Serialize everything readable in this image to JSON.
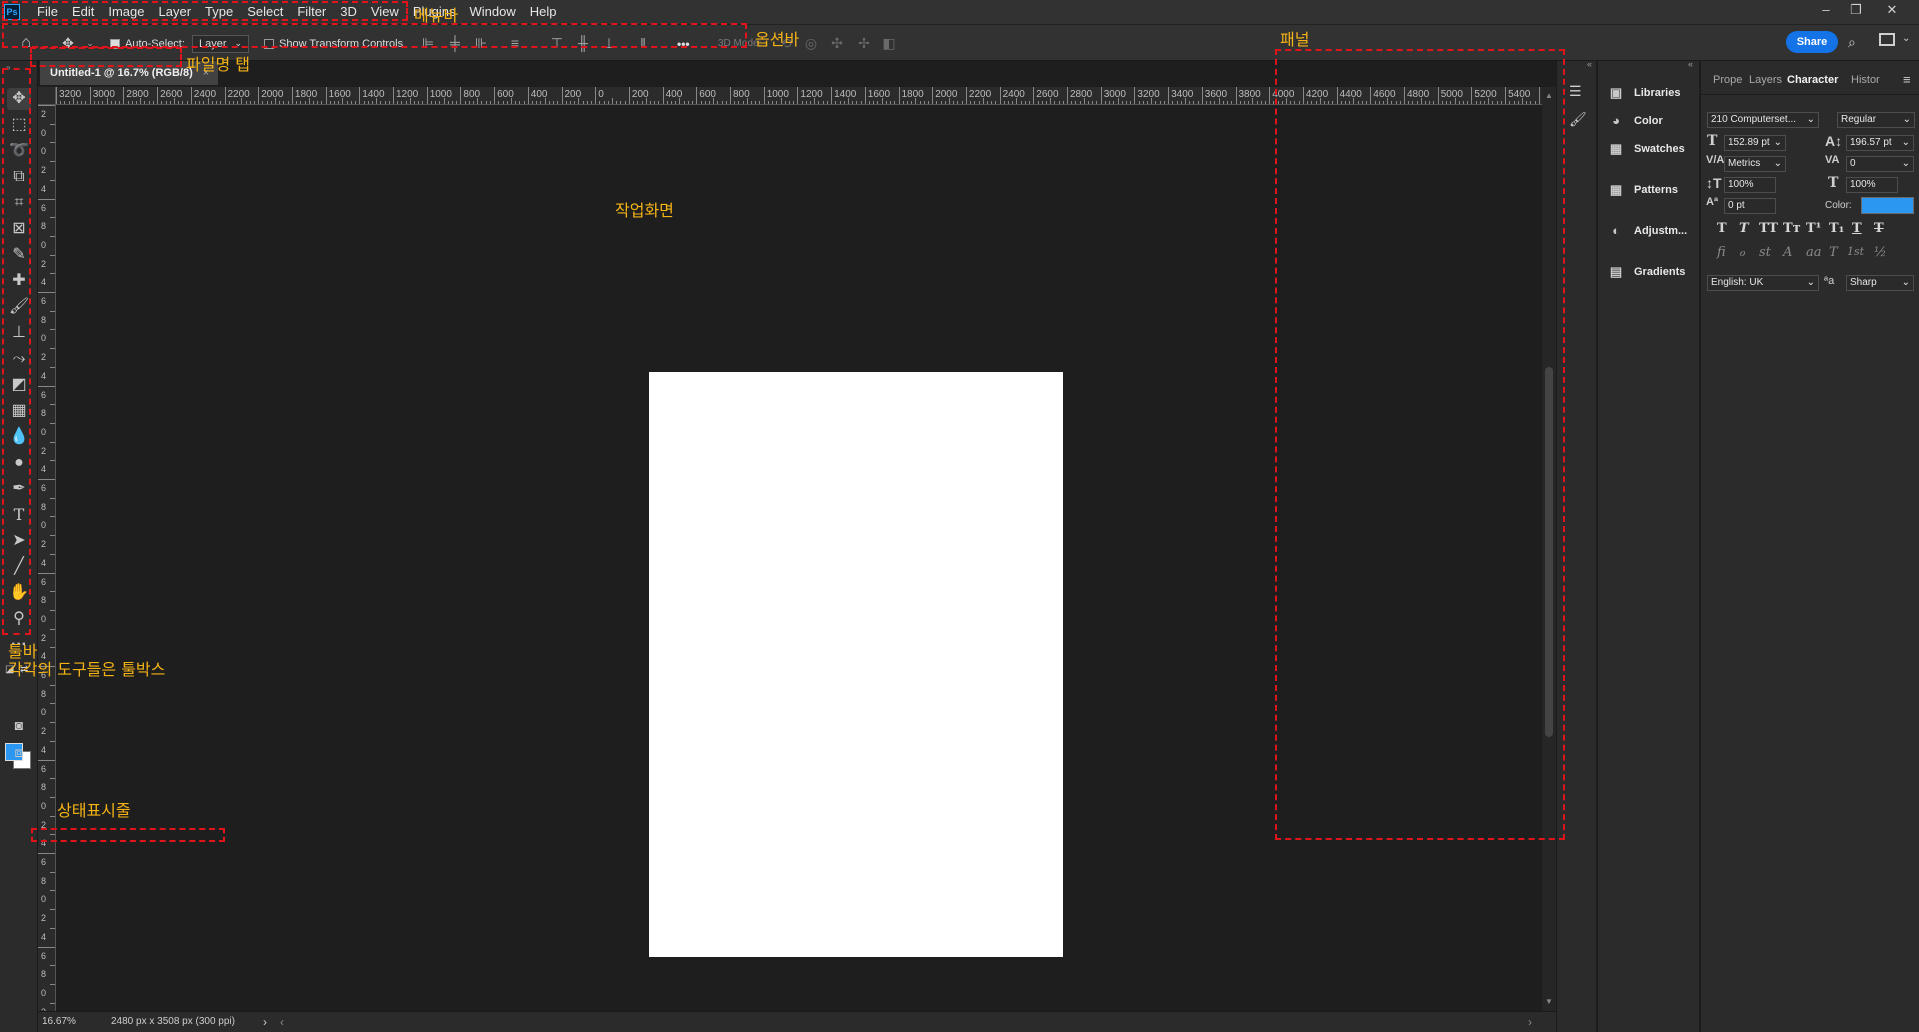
{
  "menubar": {
    "logo": "Ps",
    "items": [
      "File",
      "Edit",
      "Image",
      "Layer",
      "Type",
      "Select",
      "Filter",
      "3D",
      "View",
      "Plugins",
      "Window",
      "Help"
    ]
  },
  "window_controls": [
    "–",
    "❐",
    "✕"
  ],
  "options_bar": {
    "auto_select_label": "Auto-Select:",
    "auto_select_checked": true,
    "auto_select_target": "Layer",
    "show_transform_label": "Show Transform Controls",
    "show_transform_checked": false,
    "more_label": "•••",
    "mode_3d_label": "3D Mode:",
    "share_label": "Share"
  },
  "document_tab": {
    "title": "Untitled-1 @ 16.7% (RGB/8)",
    "close": "×"
  },
  "ruler_h_labels": [
    "3200",
    "3000",
    "2800",
    "2600",
    "2400",
    "2200",
    "2000",
    "1800",
    "1600",
    "1400",
    "1200",
    "1000",
    "800",
    "600",
    "400",
    "200",
    "0",
    "200",
    "400",
    "600",
    "800",
    "1000",
    "1200",
    "1400",
    "1600",
    "1800",
    "2000",
    "2200",
    "2400",
    "2600",
    "2800",
    "3000",
    "3200",
    "3400",
    "3600",
    "3800",
    "4000",
    "4200",
    "4400",
    "4600",
    "4800",
    "5000",
    "5200",
    "5400",
    "560"
  ],
  "ruler_v_labels": [
    "2",
    "0",
    "0",
    "2",
    "4",
    "6",
    "8",
    "0",
    "2",
    "4",
    "6",
    "8",
    "0",
    "2",
    "4",
    "6",
    "8",
    "0",
    "2",
    "4",
    "6",
    "8",
    "0",
    "2",
    "4",
    "6",
    "8",
    "0",
    "2",
    "4",
    "6",
    "8",
    "0",
    "2",
    "4",
    "6",
    "8",
    "0",
    "2",
    "4",
    "6",
    "8",
    "0",
    "2",
    "4",
    "6",
    "8",
    "0",
    "2"
  ],
  "status_bar": {
    "zoom": "16.67%",
    "doc_info": "2480 px x 3508 px (300 ppi)",
    "arrow": "›"
  },
  "panel_list": [
    {
      "label": "Libraries",
      "icon": "libraries-icon"
    },
    {
      "label": "Color",
      "icon": "color-palette-icon"
    },
    {
      "label": "Swatches",
      "icon": "swatches-grid-icon"
    },
    {
      "label": "Patterns",
      "icon": "patterns-grid-icon"
    },
    {
      "label": "Adjustm...",
      "icon": "adjustments-icon"
    },
    {
      "label": "Gradients",
      "icon": "gradient-icon"
    }
  ],
  "panel_tabs": [
    "Prope",
    "Layers",
    "Character",
    "Histor"
  ],
  "character": {
    "font_family": "210 Computerset...",
    "font_style": "Regular",
    "font_size": "152.89 pt",
    "leading": "196.57 pt",
    "kerning": "Metrics",
    "tracking": "0",
    "vertical_scale": "100%",
    "horizontal_scale": "100%",
    "baseline_shift": "0 pt",
    "color_label": "Color:",
    "color_value": "#2c97f0",
    "type_style_buttons": [
      "T",
      "T",
      "TT",
      "Tт",
      "T¹",
      "T₁",
      "T",
      "T"
    ],
    "opentype_buttons": [
      "ﬁ",
      "ℴ",
      "st",
      "A",
      "aa",
      "T",
      "1st",
      "½"
    ],
    "language": "English: UK",
    "aa_label": "ªa",
    "antialias": "Sharp"
  },
  "annotations": {
    "menubar": "메뉴바",
    "optionsbar": "옵션바",
    "panel": "패널",
    "filetab": "파일명 탭",
    "workspace": "작업화면",
    "toolbar_title": "툴바",
    "toolbar_desc": "각각의 도구들은 툴박스",
    "statusbar": "상태표시줄"
  },
  "colors": {
    "foreground": "#2c97f0",
    "background": "#ffffff",
    "annotation": "#f5b316",
    "dash": "#e0141b"
  }
}
